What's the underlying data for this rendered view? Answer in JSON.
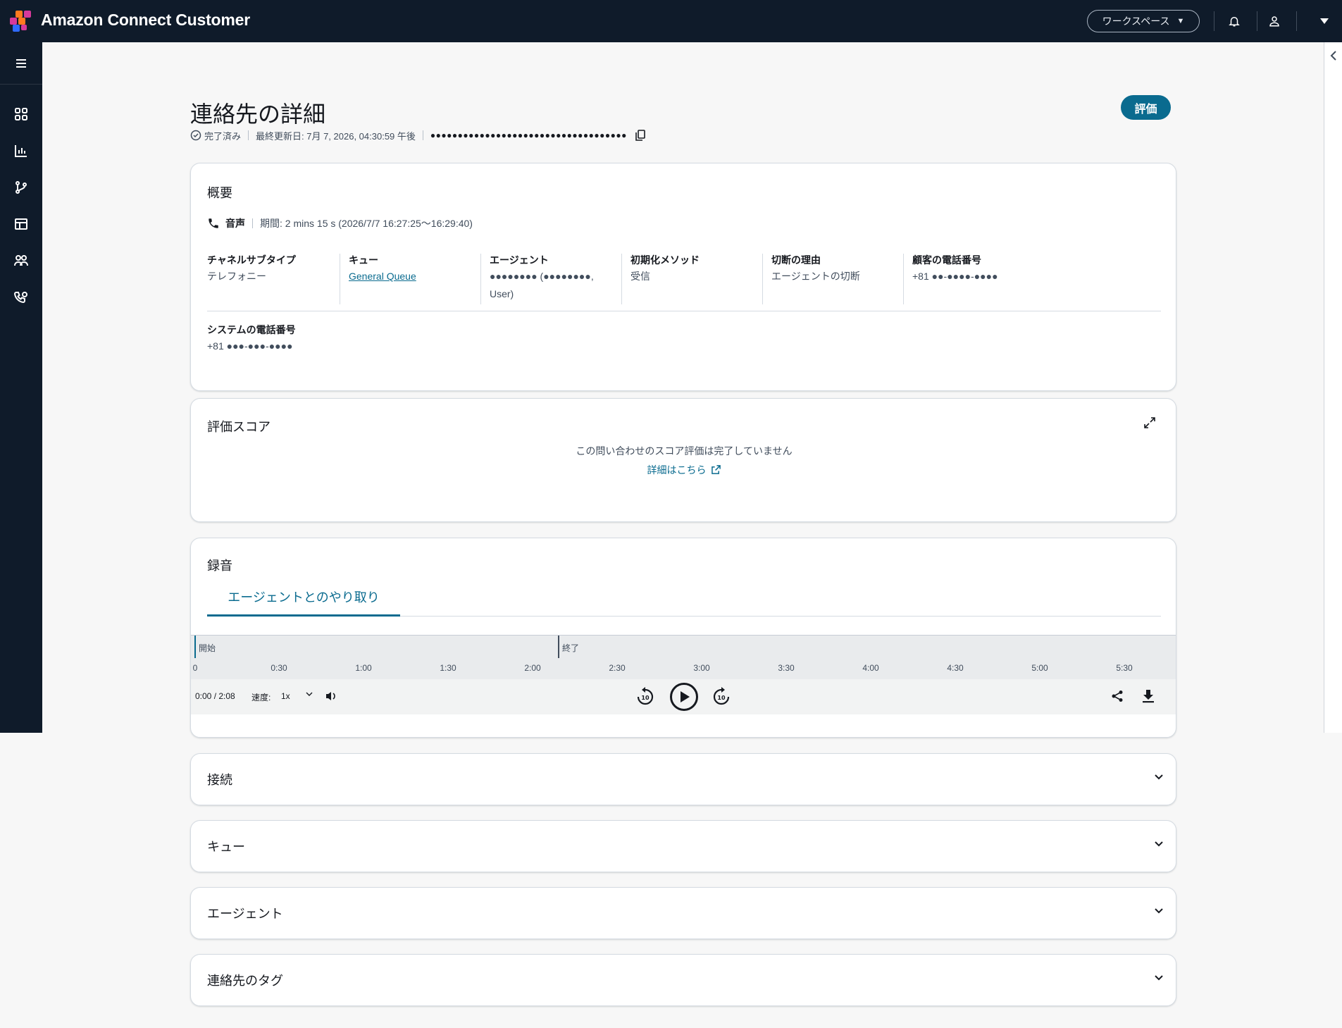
{
  "app": {
    "title": "Amazon Connect Customer",
    "workspace_label": "ワークスペース"
  },
  "colors": {
    "topbar_bg": "#0f1b2a",
    "primary": "#0a6b8f",
    "logo_orange": "#ff7a1f",
    "logo_magenta": "#d6399a",
    "logo_blue": "#2f6bff"
  },
  "sidebar": {
    "items": [
      {
        "icon": "menu-icon"
      },
      {
        "icon": "dashboard-icon"
      },
      {
        "icon": "analytics-icon"
      },
      {
        "icon": "flow-icon"
      },
      {
        "icon": "table-icon"
      },
      {
        "icon": "users-icon"
      },
      {
        "icon": "phone-routing-icon"
      }
    ]
  },
  "page": {
    "title": "連絡先の詳細",
    "status": "完了済み",
    "last_updated": "最終更新日: 7月 7, 2026, 04:30:59 午後",
    "contact_id_masked": "●●●●●●●●●●●●●●●●●●●●●●●●●●●●●●●●●●●●",
    "evaluate_button": "評価"
  },
  "overview": {
    "title": "概要",
    "channel": "音声",
    "duration": "期間: 2 mins 15 s (2026/7/7 16:27:25～16:29:40)",
    "fields": [
      {
        "label": "チャネルサブタイプ",
        "value": "テレフォニー"
      },
      {
        "label": "キュー",
        "value": "General Queue"
      },
      {
        "label": "エージェント",
        "value": "●●●●●●●● (●●●●●●●●, User)"
      },
      {
        "label": "初期化メソッド",
        "value": "受信"
      },
      {
        "label": "切断の理由",
        "value": "エージェントの切断"
      },
      {
        "label": "顧客の電話番号",
        "value": "+81 ●●-●●●●-●●●●"
      }
    ],
    "system_phone": {
      "label": "システムの電話番号",
      "value": "+81 ●●●-●●●-●●●●"
    }
  },
  "score": {
    "title": "評価スコア",
    "message": "この問い合わせのスコア評価は完了していません",
    "link": "詳細はこちら"
  },
  "recording": {
    "title": "録音",
    "tab": "エージェントとのやり取り",
    "start_label": "開始",
    "end_label": "終了",
    "ticks": [
      "0",
      "0:30",
      "1:00",
      "1:30",
      "2:00",
      "2:30",
      "3:00",
      "3:30",
      "4:00",
      "4:30",
      "5:00",
      "5:30"
    ],
    "time": "0:00 / 2:08",
    "speed_label": "速度:",
    "speed_value": "1x"
  },
  "sections": [
    {
      "title": "接続"
    },
    {
      "title": "キュー"
    },
    {
      "title": "エージェント"
    },
    {
      "title": "連絡先のタグ"
    }
  ]
}
